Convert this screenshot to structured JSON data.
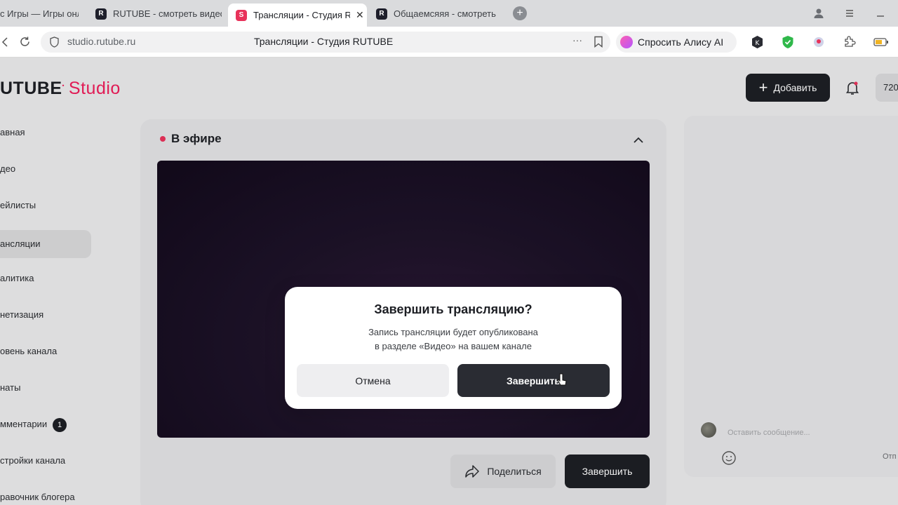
{
  "browser": {
    "tabs": [
      {
        "label": "с Игры — Игры онл",
        "favicon": "none"
      },
      {
        "label": "RUTUBE - смотреть видео",
        "favicon": "R"
      },
      {
        "label": "Трансляции - Студия R",
        "favicon": "S"
      },
      {
        "label": "Общаемсяяя - смотреть",
        "favicon": "R"
      }
    ],
    "new_tab_icon": "+",
    "url": "studio.rutube.ru",
    "page_title": "Трансляции - Студия RUTUBE",
    "more_icon": "···",
    "alice_label": "Спросить Алису AI"
  },
  "app": {
    "logo_main": "UTUBE",
    "logo_studio": "Studio",
    "add_button": "Добавить",
    "profile_chip": "720"
  },
  "sidebar": {
    "items": [
      {
        "label": "авная"
      },
      {
        "label": "део"
      },
      {
        "label": "ейлисты"
      },
      {
        "label": "ансляции"
      },
      {
        "label": "алитика"
      },
      {
        "label": "нетизация"
      },
      {
        "label": "овень канала"
      },
      {
        "label": "наты"
      },
      {
        "label": "мментарии",
        "badge": "1"
      },
      {
        "label": "стройки канала"
      },
      {
        "label": "равочник блогера"
      }
    ]
  },
  "stream": {
    "status": "В эфире",
    "share_button": "Поделиться",
    "finish_button": "Завершить"
  },
  "chat": {
    "placeholder": "Оставить сообщение...",
    "send_label": "Отп"
  },
  "modal": {
    "title": "Завершить трансляцию?",
    "line1": "Запись трансляции будет опубликована",
    "line2": "в разделе «Видео» на вашем канале",
    "cancel": "Отмена",
    "confirm": "Завершить"
  },
  "colors": {
    "accent": "#ed1d5a",
    "dark_button": "#1d1f24",
    "live_dot": "#e8325a"
  }
}
